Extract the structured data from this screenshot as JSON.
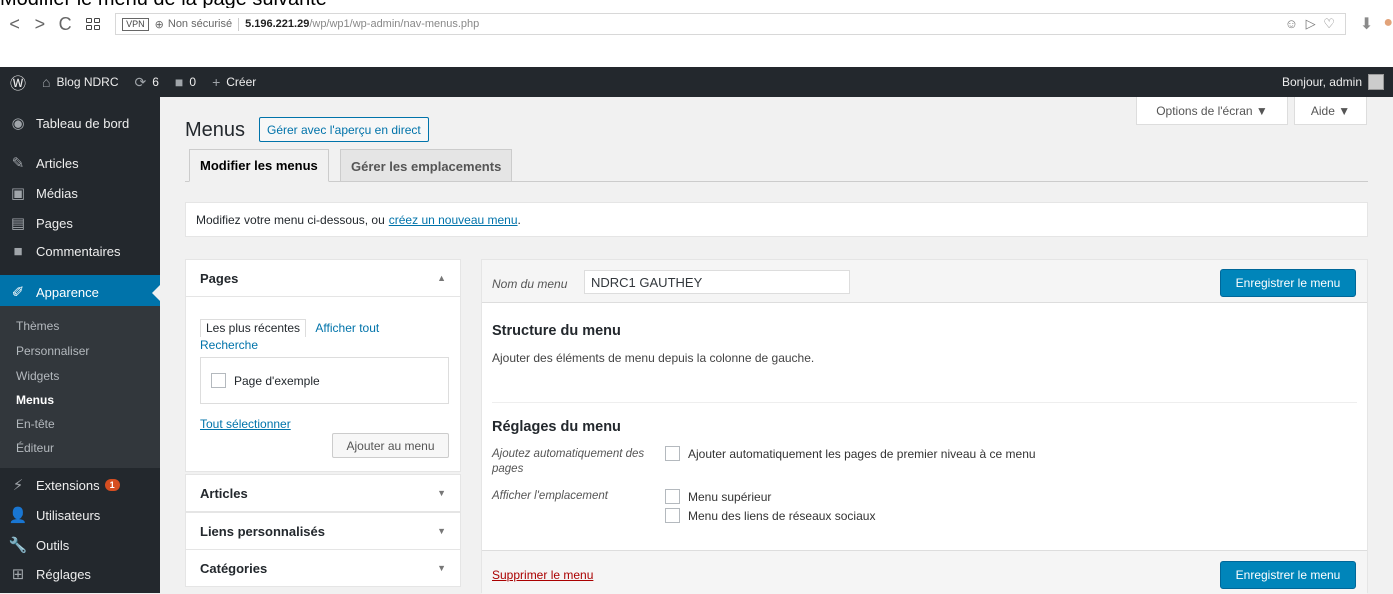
{
  "top_strip_text": "Modifier le menu de la page suivante",
  "browser": {
    "back": "<",
    "forward": ">",
    "reload": "C",
    "vpn": "VPN",
    "security": "Non sécurisé",
    "host": "5.196.221.29",
    "path": "/wp/wp1/wp-admin/nav-menus.php",
    "tools": "☺ ▷ ♡"
  },
  "adminbar": {
    "site": "Blog NDRC",
    "updates": "6",
    "comments": "0",
    "new": "Créer",
    "greeting": "Bonjour, admin"
  },
  "sidebar": {
    "dashboard": "Tableau de bord",
    "posts": "Articles",
    "media": "Médias",
    "pages": "Pages",
    "comments": "Commentaires",
    "appearance": "Apparence",
    "submenu": [
      "Thèmes",
      "Personnaliser",
      "Widgets",
      "Menus",
      "En-tête",
      "Éditeur"
    ],
    "plugins": "Extensions",
    "plugins_badge": "1",
    "users": "Utilisateurs",
    "tools": "Outils",
    "settings": "Réglages"
  },
  "screen_options": "Options de l'écran ▼",
  "help": "Aide ▼",
  "page_title": "Menus",
  "live_preview": "Gérer avec l'aperçu en direct",
  "tabs": [
    "Modifier les menus",
    "Gérer les emplacements"
  ],
  "notice": {
    "text": "Modifiez votre menu ci-dessous, ou",
    "link": "créez un nouveau menu",
    "end": "."
  },
  "left_panel": {
    "pages_title": "Pages",
    "tab_recent": "Les plus récentes",
    "tab_all": "Afficher tout",
    "tab_search": "Recherche",
    "page_item": "Page d'exemple",
    "select_all": "Tout sélectionner",
    "add_button": "Ajouter au menu",
    "sections": [
      "Articles",
      "Liens personnalisés",
      "Catégories"
    ]
  },
  "editor": {
    "name_label": "Nom du menu",
    "name_value": "NDRC1 GAUTHEY",
    "save": "Enregistrer le menu",
    "structure_title": "Structure du menu",
    "structure_desc": "Ajouter des éléments de menu depuis la colonne de gauche.",
    "settings_title": "Réglages du menu",
    "auto_label": "Ajoutez automatiquement des pages",
    "auto_option": "Ajouter automatiquement les pages de premier niveau à ce menu",
    "location_label": "Afficher l'emplacement",
    "locations": [
      "Menu supérieur",
      "Menu des liens de réseaux sociaux"
    ],
    "delete": "Supprimer le menu"
  }
}
